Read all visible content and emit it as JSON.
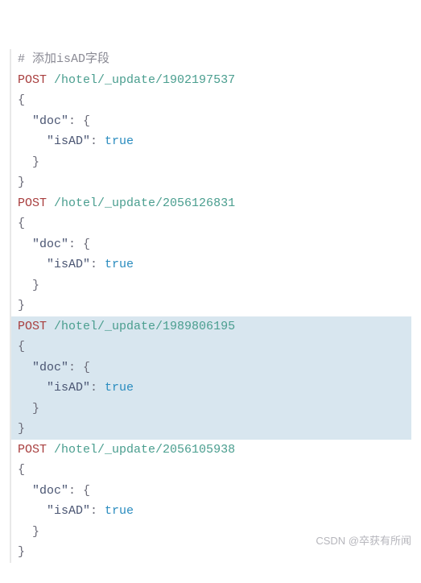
{
  "comment": "# 添加isAD字段",
  "requests": [
    {
      "method": "POST",
      "path": "/hotel/_update/1902197537",
      "highlighted": false,
      "open_brace": "{",
      "doc_key": "\"doc\"",
      "doc_open": ": {",
      "field_key": "\"isAD\"",
      "field_sep": ": ",
      "field_value": "true",
      "doc_close": "}",
      "close_brace": "}"
    },
    {
      "method": "POST",
      "path": "/hotel/_update/2056126831",
      "highlighted": false,
      "open_brace": "{",
      "doc_key": "\"doc\"",
      "doc_open": ": {",
      "field_key": "\"isAD\"",
      "field_sep": ": ",
      "field_value": "true",
      "doc_close": "}",
      "close_brace": "}"
    },
    {
      "method": "POST",
      "path": "/hotel/_update/1989806195",
      "highlighted": true,
      "open_brace": "{",
      "doc_key": "\"doc\"",
      "doc_open": ": {",
      "field_key": "\"isAD\"",
      "field_sep": ": ",
      "field_value": "true",
      "doc_close": "}",
      "close_brace": "}"
    },
    {
      "method": "POST",
      "path": "/hotel/_update/2056105938",
      "highlighted": false,
      "open_brace": "{",
      "doc_key": "\"doc\"",
      "doc_open": ": {",
      "field_key": "\"isAD\"",
      "field_sep": ": ",
      "field_value": "true",
      "doc_close": "}",
      "close_brace": "}"
    }
  ],
  "watermark": "CSDN @卒获有所闻"
}
